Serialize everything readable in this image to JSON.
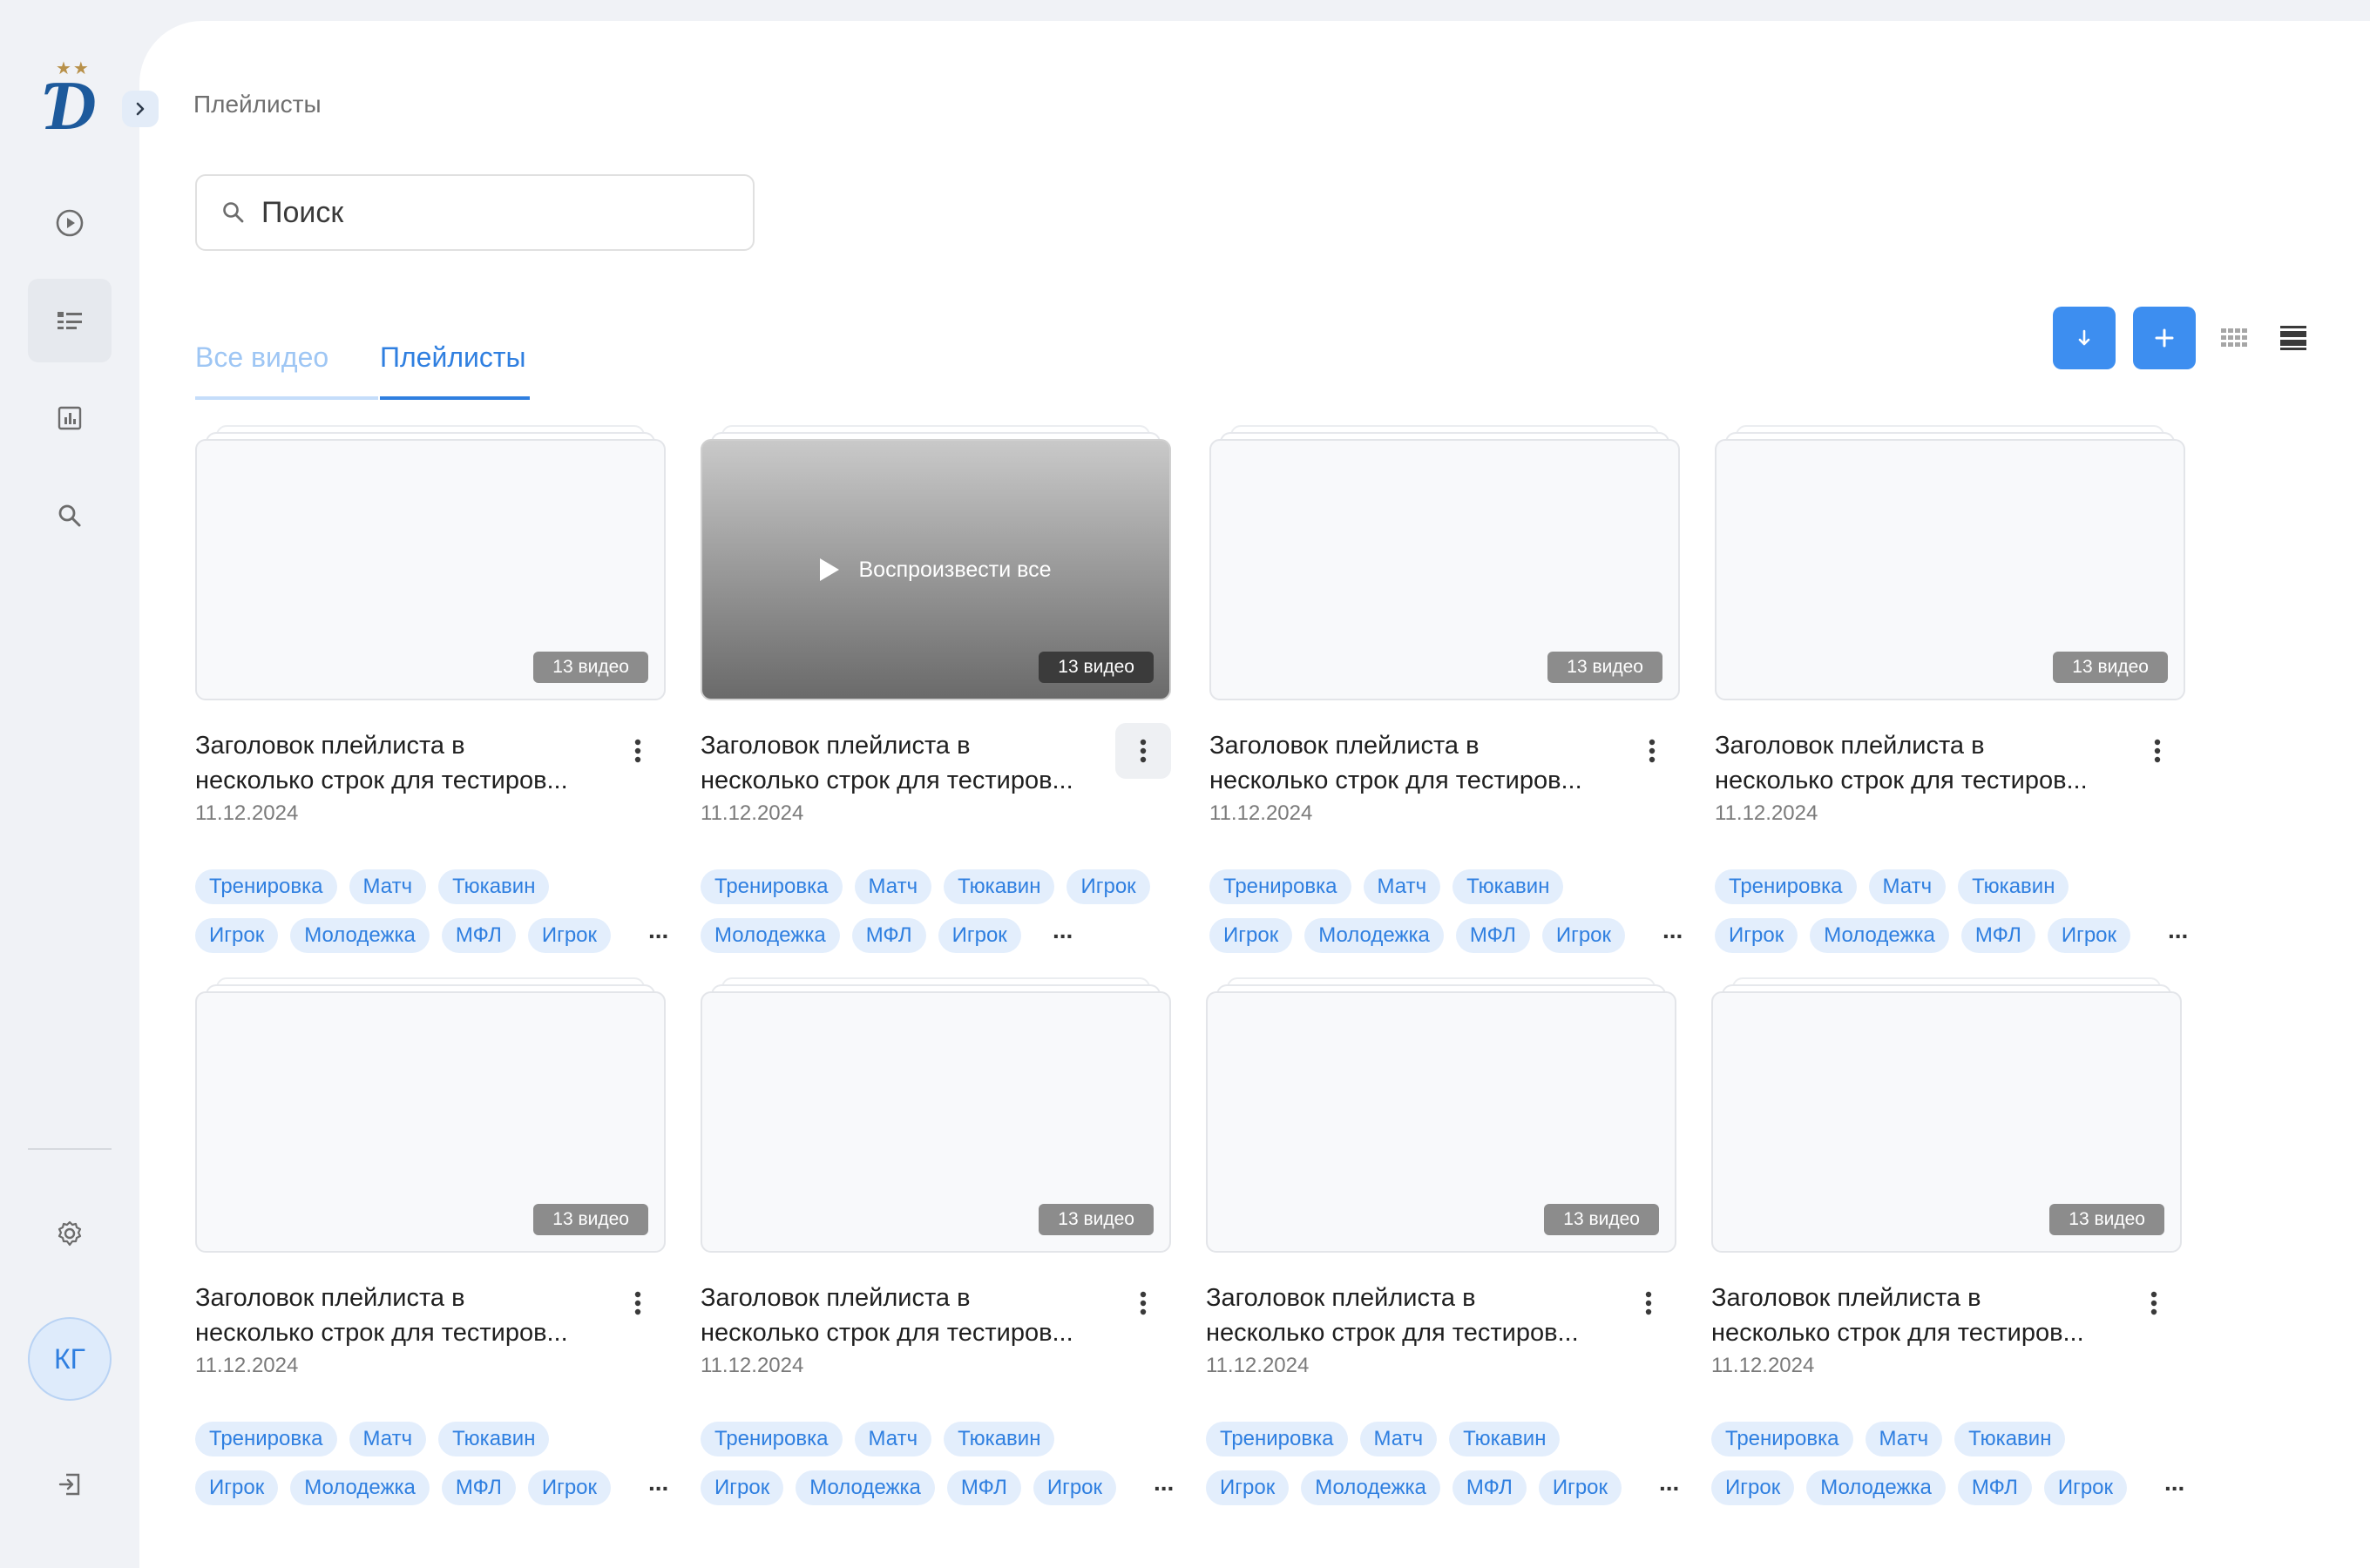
{
  "user": {
    "initials": "КГ"
  },
  "breadcrumb": "Плейлисты",
  "search": {
    "placeholder": "Поиск"
  },
  "tabs": [
    {
      "label": "Все видео"
    },
    {
      "label": "Плейлисты"
    }
  ],
  "hover_action": "Воспроизвести все",
  "ellipsis": "...",
  "playlists": [
    {
      "title_line1": "Заголовок плейлиста в",
      "title_line2": "несколько строк для тестиров...",
      "date": "11.12.2024",
      "count": "13 видео",
      "tags_row1": [
        "Тренировка",
        "Матч",
        "Тюкавин"
      ],
      "tags_row2": [
        "Игрок",
        "Молодежка",
        "МФЛ",
        "Игрок"
      ]
    },
    {
      "title_line1": "Заголовок плейлиста в",
      "title_line2": "несколько строк для тестиров...",
      "date": "11.12.2024",
      "count": "13 видео",
      "tags_row1": [
        "Тренировка",
        "Матч",
        "Тюкавин",
        "Игрок"
      ],
      "tags_row2": [
        "Молодежка",
        "МФЛ",
        "Игрок"
      ]
    },
    {
      "title_line1": "Заголовок плейлиста в",
      "title_line2": "несколько строк для тестиров...",
      "date": "11.12.2024",
      "count": "13 видео",
      "tags_row1": [
        "Тренировка",
        "Матч",
        "Тюкавин"
      ],
      "tags_row2": [
        "Игрок",
        "Молодежка",
        "МФЛ",
        "Игрок"
      ]
    },
    {
      "title_line1": "Заголовок плейлиста в",
      "title_line2": "несколько строк для тестиров...",
      "date": "11.12.2024",
      "count": "13 видео",
      "tags_row1": [
        "Тренировка",
        "Матч",
        "Тюкавин"
      ],
      "tags_row2": [
        "Игрок",
        "Молодежка",
        "МФЛ",
        "Игрок"
      ]
    },
    {
      "title_line1": "Заголовок плейлиста в",
      "title_line2": "несколько строк для тестиров...",
      "date": "11.12.2024",
      "count": "13 видео",
      "tags_row1": [
        "Тренировка",
        "Матч",
        "Тюкавин"
      ],
      "tags_row2": [
        "Игрок",
        "Молодежка",
        "МФЛ",
        "Игрок"
      ]
    },
    {
      "title_line1": "Заголовок плейлиста в",
      "title_line2": "несколько строк для тестиров...",
      "date": "11.12.2024",
      "count": "13 видео",
      "tags_row1": [
        "Тренировка",
        "Матч",
        "Тюкавин"
      ],
      "tags_row2": [
        "Игрок",
        "Молодежка",
        "МФЛ",
        "Игрок"
      ]
    },
    {
      "title_line1": "Заголовок плейлиста в",
      "title_line2": "несколько строк для тестиров...",
      "date": "11.12.2024",
      "count": "13 видео",
      "tags_row1": [
        "Тренировка",
        "Матч",
        "Тюкавин"
      ],
      "tags_row2": [
        "Игрок",
        "Молодежка",
        "МФЛ",
        "Игрок"
      ]
    },
    {
      "title_line1": "Заголовок плейлиста в",
      "title_line2": "несколько строк для тестиров...",
      "date": "11.12.2024",
      "count": "13 видео",
      "tags_row1": [
        "Тренировка",
        "Матч",
        "Тюкавин"
      ],
      "tags_row2": [
        "Игрок",
        "Молодежка",
        "МФЛ",
        "Игрок"
      ]
    }
  ]
}
